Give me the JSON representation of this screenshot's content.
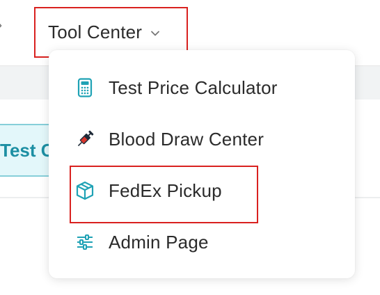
{
  "header": {
    "left_fragment": "›",
    "tool_center_label": "Tool Center"
  },
  "background": {
    "tab_label": "Test C"
  },
  "dropdown": {
    "items": [
      {
        "label": "Test Price Calculator",
        "icon": "calculator-icon"
      },
      {
        "label": "Blood Draw Center",
        "icon": "syringe-icon"
      },
      {
        "label": "FedEx Pickup",
        "icon": "package-box-icon"
      },
      {
        "label": "Admin Page",
        "icon": "sliders-icon"
      }
    ]
  },
  "colors": {
    "accent": "#1fa2b5",
    "highlight_border": "#d9211f",
    "text": "#2b2b2b"
  }
}
